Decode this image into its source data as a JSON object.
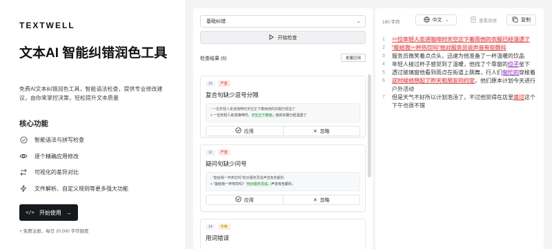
{
  "brand": {
    "name": "TEXTWELL",
    "accent": "#e2a43b"
  },
  "hero": {
    "title": "文本AI 智能纠错润色工具",
    "description": "免费AI文本纠错润色工具，智能语法检查，提供专业修改建议，由你来掌控决策，轻松提升文本质量",
    "features_heading": "核心功能",
    "features": [
      {
        "icon": "check-circle-icon",
        "label": "智能语法与拼写检查"
      },
      {
        "icon": "eye-icon",
        "label": "逐个精确应用修改"
      },
      {
        "icon": "compare-icon",
        "label": "可视化的差异对比"
      },
      {
        "icon": "bolt-icon",
        "label": "文件解析、自定义规则等更多强大功能"
      }
    ],
    "cta_label": "开始使用",
    "cta_note": "+ 免费注册，每日 20,000 字符额度"
  },
  "middle": {
    "mode_select": "基础纠错",
    "start_button": "开始检查",
    "results_heading": "检查结果 (6)",
    "batch_button": "批量应用",
    "cards": [
      {
        "id": "13",
        "severity": "严重",
        "severity_type": "severe",
        "title": "复合句缺少逗号分隔",
        "orig": "- 一位年轻人走进咖啡时天空正下着雨他的衣服已经湿了",
        "fix_a": "+ 一位年轻人走进咖啡时，",
        "fix_b": "天空正下着雨，",
        "fix_c": "他的衣服已经湿透了",
        "apply": "应用",
        "ignore": "忽略"
      },
      {
        "id": "12",
        "severity": "严重",
        "severity_type": "severe",
        "title": "疑问句缺少问号",
        "orig": "- \"能给我一杯热饮吗\"他对服务员说声音有些颤抖",
        "fix_a": "+ \"能给我一杯热饮吗？",
        "fix_b": "\"他对服务员说，",
        "fix_c": "声音有些颤抖。",
        "apply": "应用",
        "ignore": "忽略"
      },
      {
        "id": "14",
        "severity": "中等",
        "severity_type": "medium",
        "title": "用词错误"
      }
    ]
  },
  "right": {
    "char_count": "190 字符",
    "language": "中文",
    "view_diff": "查看改进",
    "copy": "复制",
    "lines": [
      {
        "num": "1",
        "segments": [
          {
            "t": "一位年轻人走进咖啡时天空正下着雨他的衣服已经湿透了",
            "k": "err"
          }
        ]
      },
      {
        "num": "2",
        "segments": [
          {
            "t": "\"能给我一杯热饮吗\"他对服务员说声音有些颤抖",
            "k": "err"
          }
        ]
      },
      {
        "num": "3",
        "segments": [
          {
            "t": "服务员微笑着点点头，迅速为他准备了一杯温暖的饮品",
            "k": ""
          }
        ]
      },
      {
        "num": "4",
        "segments": [
          {
            "t": "年轻人接过杯子感觉到了温暖，他找了个靠窗的",
            "k": ""
          },
          {
            "t": "位子",
            "k": "err-purple"
          },
          {
            "t": "坐下",
            "k": ""
          }
        ]
      },
      {
        "num": "5",
        "segments": [
          {
            "t": "透过玻璃窗他看到雨点在街道上跳舞，行人们",
            "k": ""
          },
          {
            "t": "匆忙的",
            "k": "err-purple"
          },
          {
            "t": "穿梭着",
            "k": ""
          }
        ]
      },
      {
        "num": "6",
        "segments": [
          {
            "t": "这时候他想起了昨天和朋友的约定",
            "k": "err"
          },
          {
            "t": "，他们原本计划今天进行户外活动",
            "k": ""
          }
        ]
      },
      {
        "num": "7",
        "segments": [
          {
            "t": "但是天气不好所以计划泡汤了，不过他觉得在店里",
            "k": ""
          },
          {
            "t": "渡过",
            "k": "err"
          },
          {
            "t": "这个下午也很不错",
            "k": ""
          }
        ]
      }
    ]
  }
}
